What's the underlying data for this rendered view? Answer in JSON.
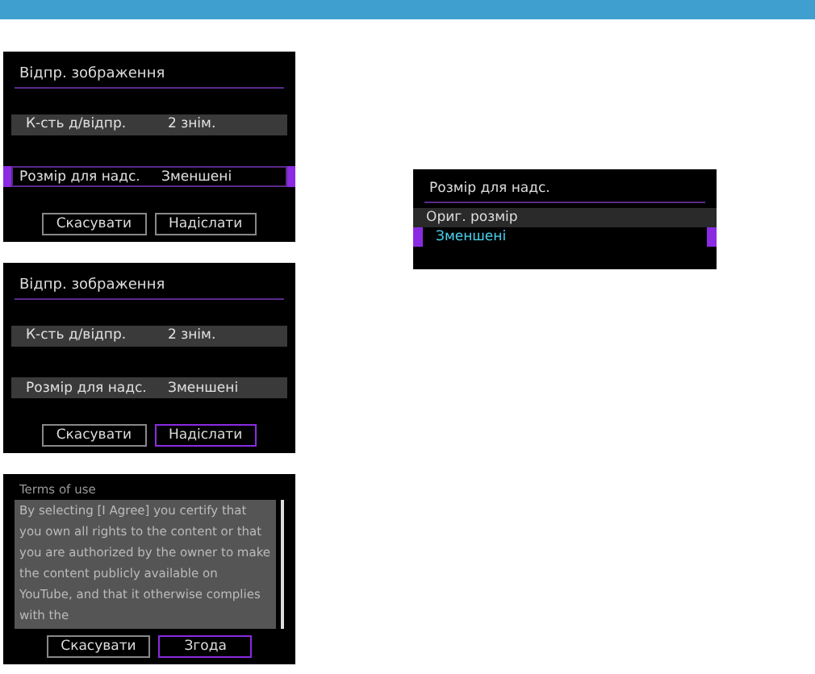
{
  "screens": [
    {
      "kind": "settings",
      "title": "Відпр. зображення",
      "rows": [
        {
          "label": "К-сть д/відпр.",
          "value": "2 знім.",
          "selected": false
        },
        {
          "label": "Розмір для надс.",
          "value": "Зменшені",
          "selected": true
        }
      ],
      "buttons": [
        {
          "label": "Скасувати",
          "selected": false
        },
        {
          "label": "Надіслати",
          "selected": false
        }
      ]
    },
    {
      "kind": "settings",
      "title": "Відпр. зображення",
      "rows": [
        {
          "label": "К-сть д/відпр.",
          "value": "2 знім.",
          "selected": false
        },
        {
          "label": "Розмір для надс.",
          "value": "Зменшені",
          "selected": false
        }
      ],
      "buttons": [
        {
          "label": "Скасувати",
          "selected": false
        },
        {
          "label": "Надіслати",
          "selected": true
        }
      ]
    },
    {
      "kind": "terms",
      "title": "Terms of use",
      "text": "By selecting [I Agree] you certify that you own all rights to the content or that you are authorized by the owner to make the content publicly available on YouTube, and that it otherwise complies with the",
      "buttons": [
        {
          "label": "Скасувати",
          "selected": false
        },
        {
          "label": "Згода",
          "selected": true
        }
      ]
    }
  ],
  "menu": {
    "title": "Розмір для надс.",
    "options": [
      {
        "label": "Ориг. розмір",
        "selected": false
      },
      {
        "label": "Зменшені",
        "selected": true
      }
    ]
  }
}
